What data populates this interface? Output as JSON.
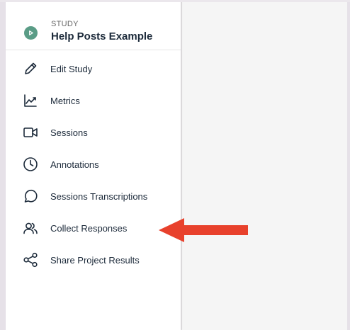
{
  "study": {
    "eyebrow": "STUDY",
    "title": "Help Posts Example",
    "badge_icon": "play-icon",
    "badge_color": "#5a9c86"
  },
  "nav": {
    "items": [
      {
        "label": "Edit Study",
        "icon": "pencil-icon"
      },
      {
        "label": "Metrics",
        "icon": "chart-icon"
      },
      {
        "label": "Sessions",
        "icon": "video-camera-icon"
      },
      {
        "label": "Annotations",
        "icon": "clock-icon"
      },
      {
        "label": "Sessions Transcriptions",
        "icon": "speech-bubble-icon"
      },
      {
        "label": "Collect Responses",
        "icon": "users-icon"
      },
      {
        "label": "Share Project Results",
        "icon": "share-icon"
      }
    ]
  },
  "annotation": {
    "arrow_color": "#e8412c",
    "points_to": "Collect Responses"
  },
  "colors": {
    "text": "#1c2a3a",
    "sidebar_bg": "#ffffff",
    "main_bg": "#f5f5f5"
  }
}
